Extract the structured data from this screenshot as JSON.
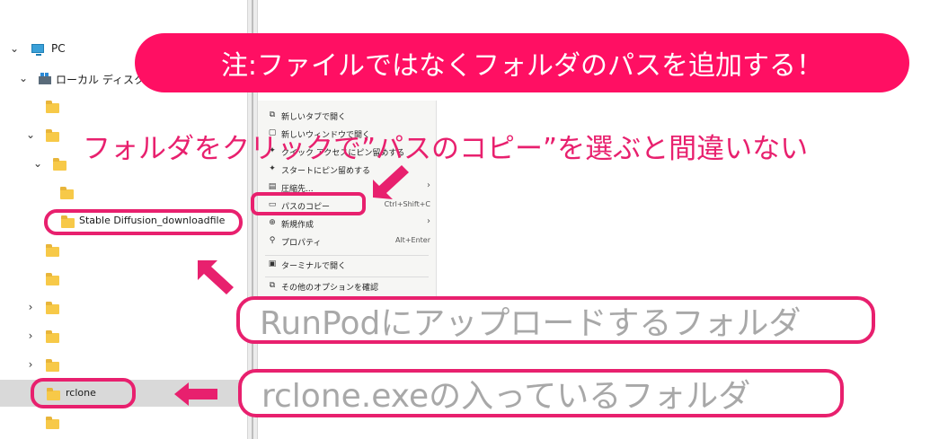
{
  "tree": {
    "pc_label": "PC",
    "drive_label": "ローカル ディスク (C",
    "sd_folder_label": "Stable Diffusion_downloadfile",
    "rclone_folder_label": "rclone"
  },
  "context_menu": {
    "items": [
      {
        "label": "新しいタブで開く",
        "shortcut": ""
      },
      {
        "label": "新しいウィンドウで開く",
        "shortcut": ""
      },
      {
        "label": "クイック アクセスにピン留めする",
        "shortcut": ""
      },
      {
        "label": "スタートにピン留めする",
        "shortcut": ""
      },
      {
        "label": "圧縮先...",
        "shortcut": ""
      },
      {
        "label": "パスのコピー",
        "shortcut": "Ctrl+Shift+C"
      },
      {
        "label": "新規作成",
        "shortcut": ""
      },
      {
        "label": "プロパティ",
        "shortcut": "Alt+Enter"
      },
      {
        "label": "ターミナルで開く",
        "shortcut": ""
      },
      {
        "label": "その他のオプションを確認",
        "shortcut": ""
      }
    ]
  },
  "annotations": {
    "banner": "注:ファイルではなくフォルダのパスを追加する！",
    "tip": "フォルダをクリックで”パスのコピー”を選ぶと間違いない",
    "runpod_callout": "RunPodにアップロードするフォルダ",
    "rclone_callout": "rclone.exeの入っているフォルダ"
  },
  "colors": {
    "accent": "#e8206e",
    "banner_bg": "#ff0f63",
    "callout_text": "#a8a8a8",
    "selected_row": "#d9d9d9",
    "folder": "#f7c948"
  }
}
